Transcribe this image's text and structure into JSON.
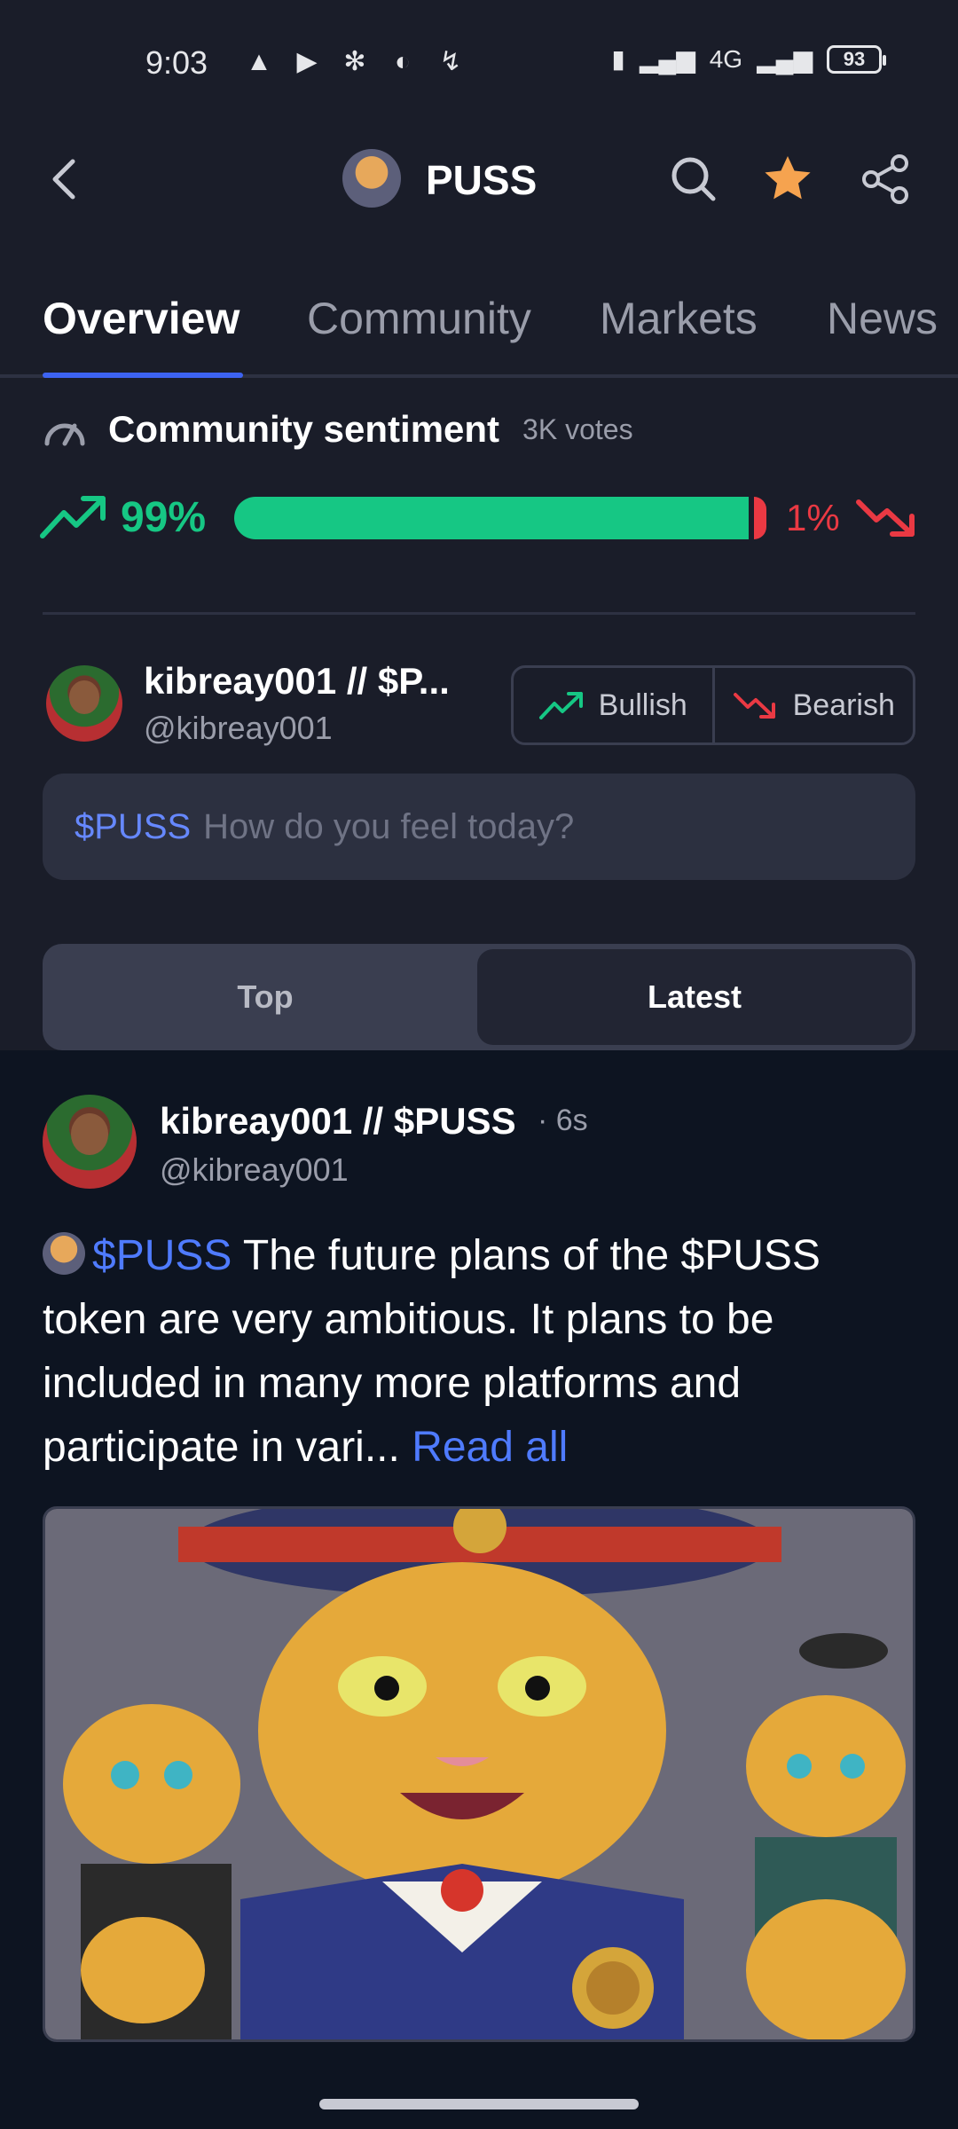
{
  "status_bar": {
    "time": "9:03",
    "battery": "93",
    "network": "4G"
  },
  "header": {
    "title": "PUSS"
  },
  "tabs": [
    {
      "label": "Overview",
      "active": true
    },
    {
      "label": "Community",
      "active": false
    },
    {
      "label": "Markets",
      "active": false
    },
    {
      "label": "News",
      "active": false
    }
  ],
  "sentiment": {
    "title": "Community sentiment",
    "votes": "3K votes",
    "bullish_label": "99%",
    "bearish_label": "1%",
    "bullish_fraction": 0.99,
    "bearish_fraction": 0.01,
    "colors": {
      "bullish": "#16c784",
      "bearish": "#ea3943"
    }
  },
  "composer": {
    "name": "kibreay001 // $P...",
    "handle": "@kibreay001",
    "bullish_button": "Bullish",
    "bearish_button": "Bearish",
    "input_tag": "$PUSS",
    "input_placeholder": "How do you feel today?"
  },
  "sort": {
    "top": "Top",
    "latest": "Latest",
    "selected": "Latest"
  },
  "post": {
    "name": "kibreay001 // $PUSS",
    "time": "· 6s",
    "handle": "@kibreay001",
    "cashtag": "$PUSS",
    "text": " The future plans of the $PUSS token are very ambitious. It plans to be included in many more platforms and participate in vari...",
    "read_all": "Read all"
  },
  "theme": {
    "accent": "#3d63f2",
    "link": "#4f7bff",
    "background": "#1a1d29",
    "feed_background": "#0d1421"
  }
}
